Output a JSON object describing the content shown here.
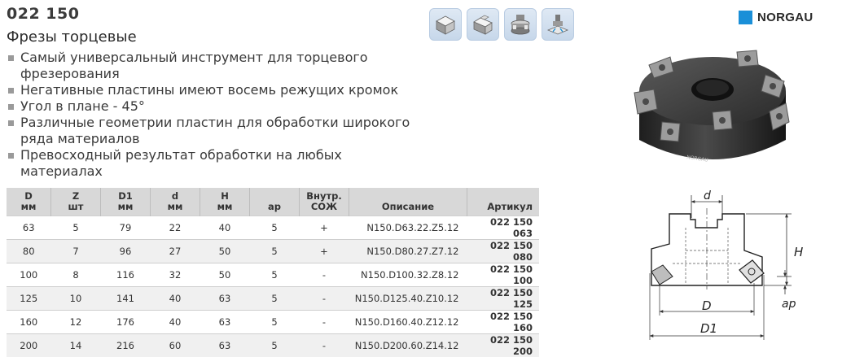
{
  "header": {
    "code": "022 150",
    "title": "Фрезы торцевые"
  },
  "bullets": [
    "Самый универсальный инструмент для торцевого фрезерования",
    "Негативные пластины имеют восемь режущих кромок",
    "Угол в плане - 45°",
    "Различные геометрии пластин для обработки широкого ряда материалов",
    "Превосходный результат обработки на любых материалах"
  ],
  "brand": {
    "name": "NORGAU",
    "color": "#1a8fd8"
  },
  "photo": {
    "engraving": "NORGAU"
  },
  "icons": [
    "face-milling-block-icon",
    "shoulder-milling-block-icon",
    "face-mill-tool-icon",
    "milling-operation-icon"
  ],
  "table": {
    "headers": [
      {
        "top": "D",
        "bottom": "мм"
      },
      {
        "top": "Z",
        "bottom": "шт"
      },
      {
        "top": "D1",
        "bottom": "мм"
      },
      {
        "top": "d",
        "bottom": "мм"
      },
      {
        "top": "H",
        "bottom": "мм"
      },
      {
        "top": "",
        "bottom": "ap"
      },
      {
        "top": "Внутр.",
        "bottom": "СОЖ"
      },
      {
        "top": "",
        "bottom": "Описание"
      },
      {
        "top": "",
        "bottom": "Артикул"
      }
    ],
    "rows": [
      [
        "63",
        "5",
        "79",
        "22",
        "40",
        "5",
        "+",
        "N150.D63.22.Z5.12",
        "022 150 063"
      ],
      [
        "80",
        "7",
        "96",
        "27",
        "50",
        "5",
        "+",
        "N150.D80.27.Z7.12",
        "022 150 080"
      ],
      [
        "100",
        "8",
        "116",
        "32",
        "50",
        "5",
        "-",
        "N150.D100.32.Z8.12",
        "022 150 100"
      ],
      [
        "125",
        "10",
        "141",
        "40",
        "63",
        "5",
        "-",
        "N150.D125.40.Z10.12",
        "022 150 125"
      ],
      [
        "160",
        "12",
        "176",
        "40",
        "63",
        "5",
        "-",
        "N150.D160.40.Z12.12",
        "022 150 160"
      ],
      [
        "200",
        "14",
        "216",
        "60",
        "63",
        "5",
        "-",
        "N150.D200.60.Z14.12",
        "022 150 200"
      ]
    ]
  },
  "drawing": {
    "labels": {
      "d": "d",
      "H": "H",
      "D": "D",
      "D1": "D1",
      "ap": "ap"
    }
  }
}
